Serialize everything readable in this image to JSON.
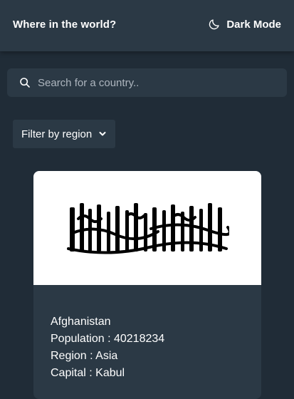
{
  "header": {
    "title": "Where in the world?",
    "mode_label": "Dark Mode",
    "mode_icon": "moon-icon"
  },
  "search": {
    "placeholder": "Search for a country..",
    "value": "",
    "icon": "search-icon"
  },
  "filter": {
    "label": "Filter by region",
    "icon": "chevron-down-icon"
  },
  "countries": [
    {
      "name": "Afghanistan",
      "population_label": "Population",
      "population": "40218234",
      "region_label": "Region",
      "region": "Asia",
      "capital_label": "Capital",
      "capital": "Kabul",
      "flag": "afghanistan-flag"
    }
  ],
  "colors": {
    "background": "#202c37",
    "elements": "#2b3945",
    "text": "#ffffff",
    "placeholder": "#aeb6bf"
  }
}
